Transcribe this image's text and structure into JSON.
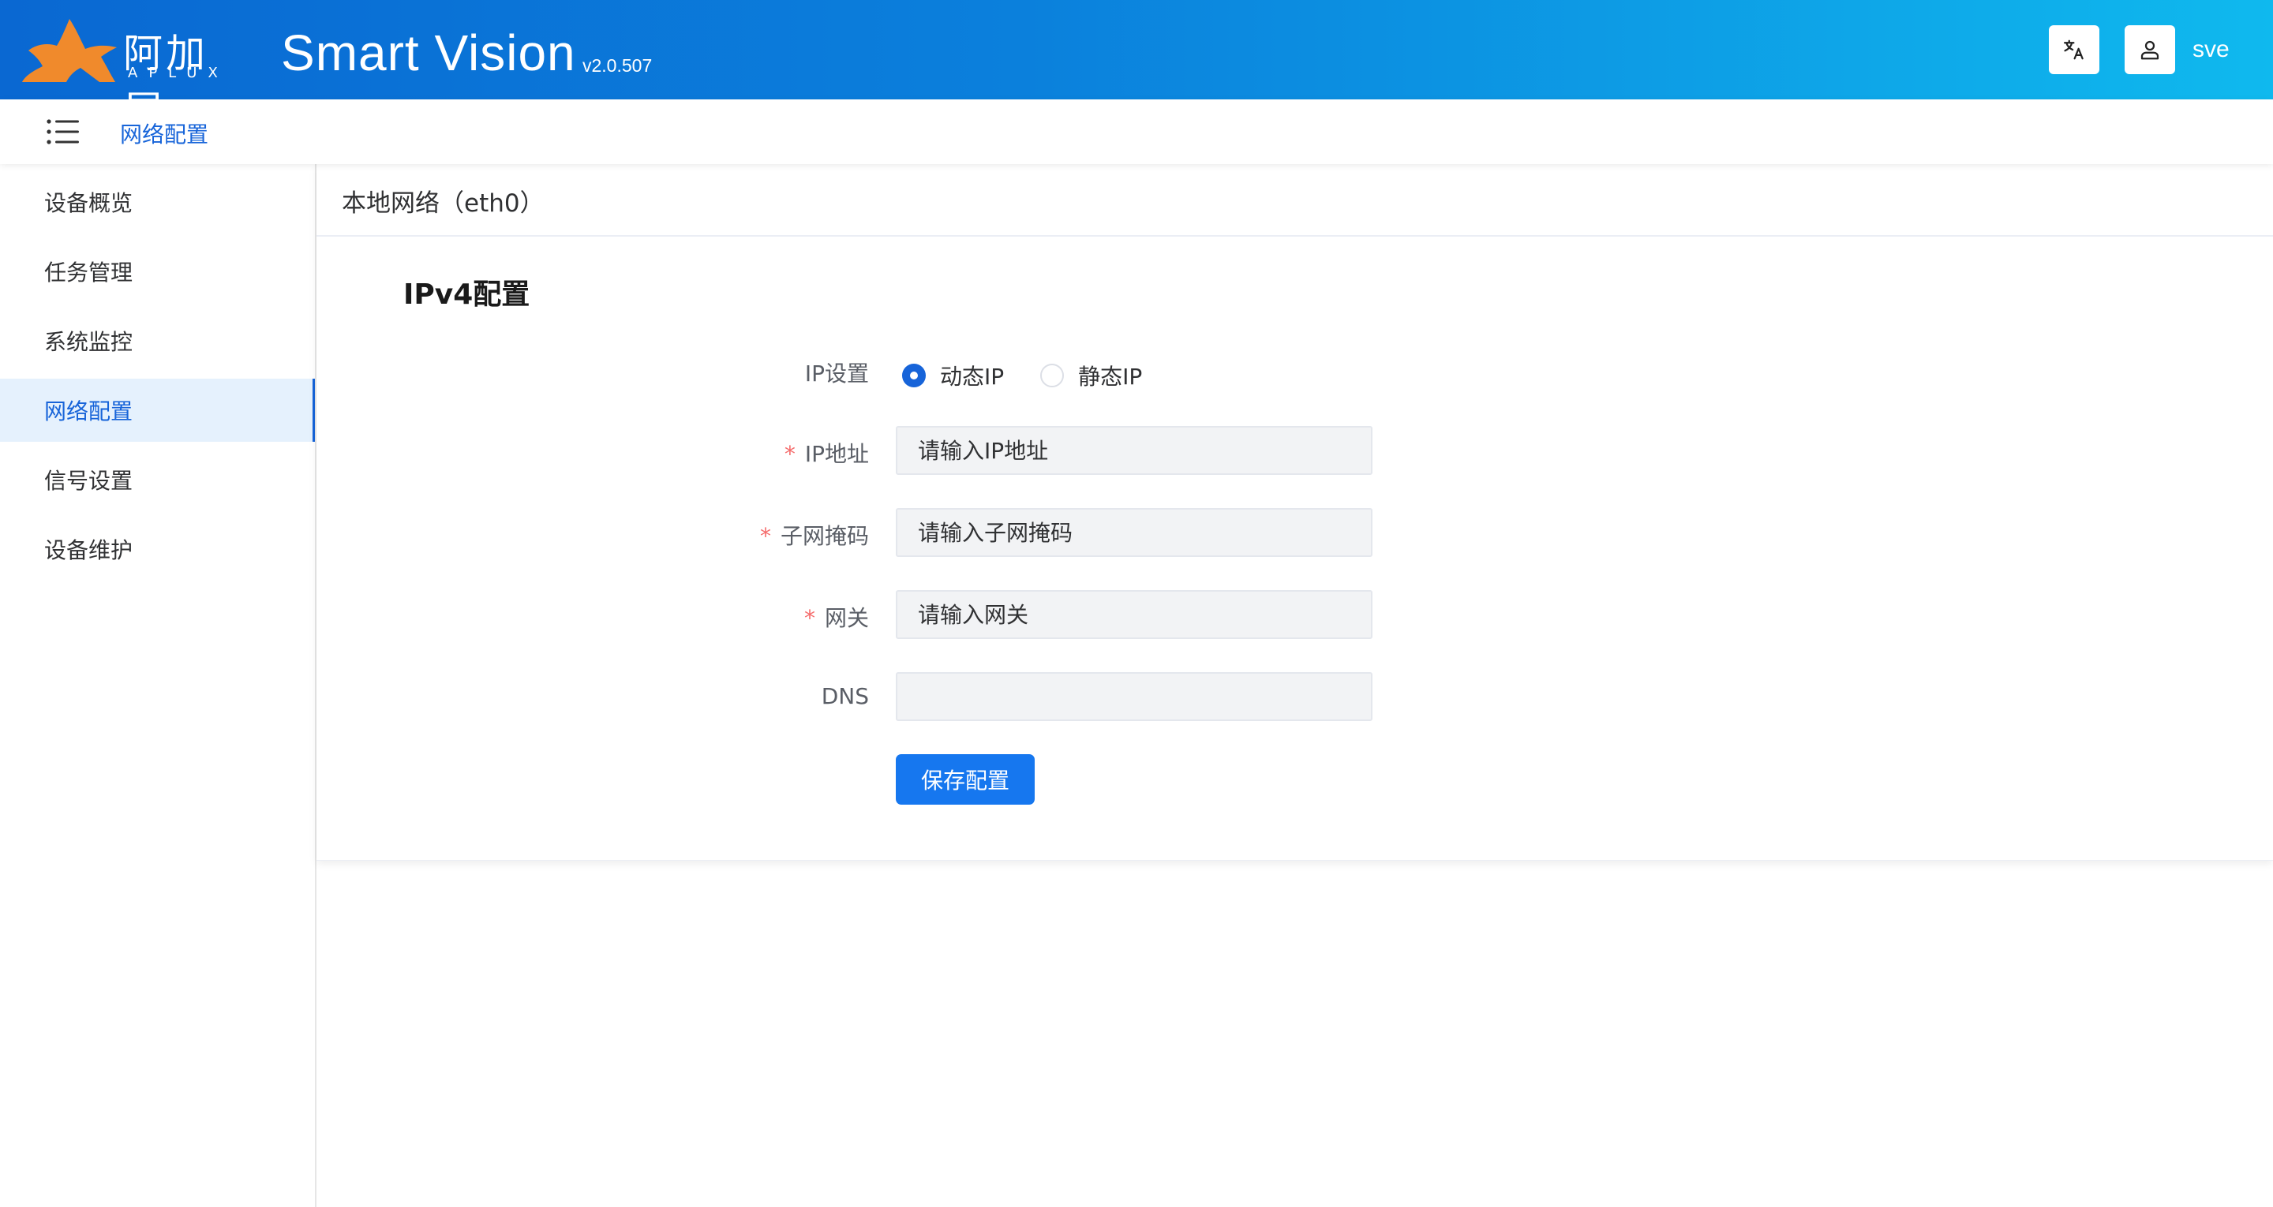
{
  "header": {
    "logo_cn": "阿加犀",
    "logo_en": "APLUX",
    "app_title": "Smart Vision",
    "version": "v2.0.507",
    "user_name": "sve",
    "gradient_start": "#0a68d2",
    "gradient_end": "#0fb9ee",
    "logo_color": "#f08a2c"
  },
  "breadcrumb": {
    "current": "网络配置"
  },
  "sidebar": {
    "items": [
      {
        "label": "设备概览"
      },
      {
        "label": "任务管理"
      },
      {
        "label": "系统监控"
      },
      {
        "label": "网络配置",
        "active": true
      },
      {
        "label": "信号设置"
      },
      {
        "label": "设备维护"
      }
    ]
  },
  "main": {
    "card_title": "本地网络（eth0）",
    "section_title": "IPv4配置",
    "ip_setting_label": "IP设置",
    "ip_mode_options": [
      {
        "label": "动态IP",
        "checked": true
      },
      {
        "label": "静态IP",
        "checked": false
      }
    ],
    "ip_address": {
      "label": "IP地址",
      "required_mark": "*",
      "placeholder": "请输入IP地址",
      "value": ""
    },
    "subnet_mask": {
      "label": "子网掩码",
      "required_mark": "*",
      "placeholder": "请输入子网掩码",
      "value": ""
    },
    "gateway": {
      "label": "网关",
      "required_mark": "*",
      "placeholder": "请输入网关",
      "value": ""
    },
    "dns": {
      "label": "DNS",
      "placeholder": "",
      "value": ""
    },
    "save_button": "保存配置"
  },
  "colors": {
    "accent": "#1764d9",
    "button": "#1677ef",
    "required": "#f56c6c",
    "active_bg": "#e5f1fd"
  }
}
